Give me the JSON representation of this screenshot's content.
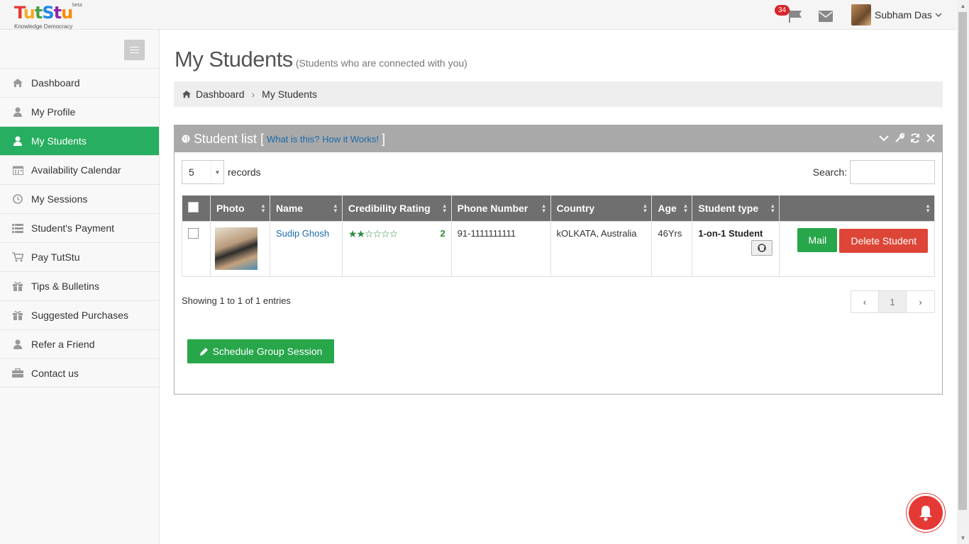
{
  "header": {
    "logo": {
      "letters": [
        "T",
        "u",
        "t",
        "S",
        "t",
        "u"
      ],
      "beta": "beta",
      "tagline": "Knowledge Democracy"
    },
    "notification_count": "34",
    "user_name": "Subham Das",
    "icons": {
      "flag": "flag-icon",
      "mail": "envelope-icon",
      "caret": "chevron-down-icon"
    }
  },
  "sidebar": {
    "items": [
      {
        "label": "Dashboard",
        "icon": "home-icon"
      },
      {
        "label": "My Profile",
        "icon": "user-icon"
      },
      {
        "label": "My Students",
        "icon": "user-icon",
        "active": true
      },
      {
        "label": "Availability Calendar",
        "icon": "calendar-icon"
      },
      {
        "label": "My Sessions",
        "icon": "clock-icon"
      },
      {
        "label": "Student's Payment",
        "icon": "list-icon"
      },
      {
        "label": "Pay TutStu",
        "icon": "cart-icon"
      },
      {
        "label": "Tips & Bulletins",
        "icon": "gift-icon"
      },
      {
        "label": "Suggested Purchases",
        "icon": "gift-icon"
      },
      {
        "label": "Refer a Friend",
        "icon": "user-icon"
      },
      {
        "label": "Contact us",
        "icon": "briefcase-icon"
      }
    ]
  },
  "page": {
    "title": "My Students",
    "subtitle": "(Students who are connected with you)",
    "breadcrumb": [
      "Dashboard",
      "My Students"
    ]
  },
  "panel": {
    "title": "Student list",
    "bracket_open": "[",
    "bracket_close": "]",
    "help_link": "What is this? How it Works!",
    "records_value": "5",
    "records_label": "records",
    "search_label": "Search:",
    "columns": [
      "Photo",
      "Name",
      "Credibility Rating",
      "Phone Number",
      "Country",
      "Age",
      "Student type",
      ""
    ],
    "rows": [
      {
        "name": "Sudip Ghosh",
        "stars": "★★☆☆☆☆",
        "rating": "2",
        "phone": "91-1111111111",
        "country": "kOLKATA, Australia",
        "age": "46Yrs",
        "type": "1-on-1 Student",
        "mail_label": "Mail",
        "delete_label": "Delete Student"
      }
    ],
    "showing": "Showing 1 to 1 of 1 entries",
    "pager": {
      "prev": "‹",
      "current": "1",
      "next": "›"
    },
    "group_button": "Schedule Group Session"
  },
  "colors": {
    "accent": "#27ae60",
    "danger": "#dd4637",
    "link": "#1b6aab",
    "panel_header": "#a9a9a9"
  }
}
